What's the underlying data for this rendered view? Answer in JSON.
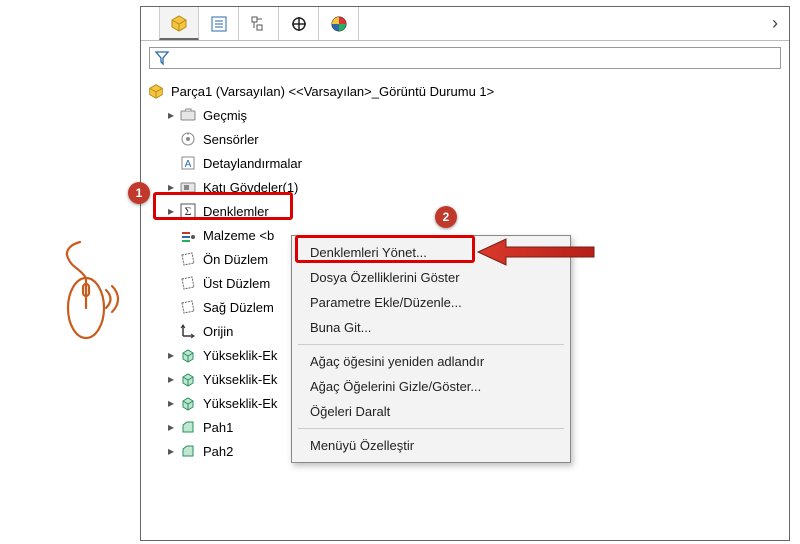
{
  "toolbar": {
    "chevron": "›"
  },
  "tree": {
    "root": "Parça1 (Varsayılan) <<Varsayılan>_Görüntü Durumu 1>",
    "items": [
      {
        "label": "Geçmiş",
        "expander": true
      },
      {
        "label": "Sensörler",
        "expander": false
      },
      {
        "label": "Detaylandırmalar",
        "expander": false
      },
      {
        "label": "Katı Gövdeler(1)",
        "expander": true
      },
      {
        "label": "Denklemler",
        "expander": true
      },
      {
        "label": "Malzeme <b",
        "expander": false
      },
      {
        "label": "Ön Düzlem",
        "expander": false
      },
      {
        "label": "Üst Düzlem",
        "expander": false
      },
      {
        "label": "Sağ Düzlem",
        "expander": false
      },
      {
        "label": "Orijin",
        "expander": false
      },
      {
        "label": "Yükseklik-Ek",
        "expander": true
      },
      {
        "label": "Yükseklik-Ek",
        "expander": true
      },
      {
        "label": "Yükseklik-Ek",
        "expander": true
      },
      {
        "label": "Pah1",
        "expander": true
      },
      {
        "label": "Pah2",
        "expander": true
      }
    ]
  },
  "context_menu": {
    "items": [
      "Denklemleri Yönet...",
      "Dosya Özelliklerini Göster",
      "Parametre Ekle/Düzenle...",
      "Buna Git...",
      "---",
      "Ağaç öğesini yeniden adlandır",
      "Ağaç Öğelerini Gizle/Göster...",
      "Öğeleri Daralt",
      "---",
      "Menüyü Özelleştir"
    ]
  },
  "callouts": {
    "one": "1",
    "two": "2"
  }
}
